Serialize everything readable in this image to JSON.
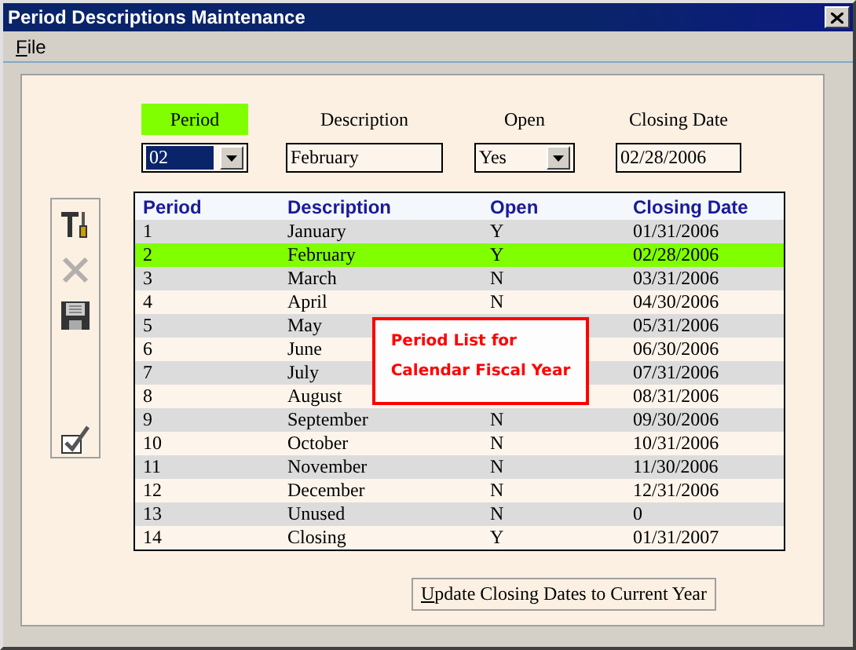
{
  "window": {
    "title": "Period Descriptions Maintenance"
  },
  "menu": [
    {
      "label": "File"
    }
  ],
  "form": {
    "fields": [
      {
        "label": "Period",
        "selected": true,
        "kind": "dropdown",
        "value": "02"
      },
      {
        "label": "Description",
        "selected": false,
        "kind": "text",
        "value": "February"
      },
      {
        "label": "Open",
        "selected": false,
        "kind": "dropdown",
        "value": "Yes"
      },
      {
        "label": "Closing Date",
        "selected": false,
        "kind": "text",
        "value": "02/28/2006"
      }
    ]
  },
  "toolbar": [
    {
      "kind": "tools",
      "disabled": false
    },
    {
      "kind": "delete",
      "disabled": true
    },
    {
      "kind": "save",
      "disabled": false
    },
    {
      "kind": "confirm",
      "disabled": false
    }
  ],
  "table": {
    "columns": [
      "Period",
      "Description",
      "Open",
      "Closing Date"
    ],
    "rows": [
      {
        "cells": [
          "1",
          "January",
          "Y",
          "01/31/2006"
        ],
        "selected": false
      },
      {
        "cells": [
          "2",
          "February",
          "Y",
          "02/28/2006"
        ],
        "selected": true
      },
      {
        "cells": [
          "3",
          "March",
          "N",
          "03/31/2006"
        ],
        "selected": false
      },
      {
        "cells": [
          "4",
          "April",
          "N",
          "04/30/2006"
        ],
        "selected": false
      },
      {
        "cells": [
          "5",
          "May",
          null,
          "05/31/2006"
        ],
        "selected": false
      },
      {
        "cells": [
          "6",
          "June",
          null,
          "06/30/2006"
        ],
        "selected": false
      },
      {
        "cells": [
          "7",
          "July",
          null,
          "07/31/2006"
        ],
        "selected": false
      },
      {
        "cells": [
          "8",
          "August",
          null,
          "08/31/2006"
        ],
        "selected": false
      },
      {
        "cells": [
          "9",
          "September",
          "N",
          "09/30/2006"
        ],
        "selected": false
      },
      {
        "cells": [
          "10",
          "October",
          "N",
          "10/31/2006"
        ],
        "selected": false
      },
      {
        "cells": [
          "11",
          "November",
          "N",
          "11/30/2006"
        ],
        "selected": false
      },
      {
        "cells": [
          "12",
          "December",
          "N",
          "12/31/2006"
        ],
        "selected": false
      },
      {
        "cells": [
          "13",
          "Unused",
          "N",
          "0"
        ],
        "selected": false
      },
      {
        "cells": [
          "14",
          "Closing",
          "Y",
          "01/31/2007"
        ],
        "selected": false
      }
    ]
  },
  "callout": {
    "lines": [
      "Period List for",
      "Calendar Fiscal Year"
    ]
  },
  "buttons": [
    {
      "label": "Update Closing Dates to Current Year"
    }
  ]
}
